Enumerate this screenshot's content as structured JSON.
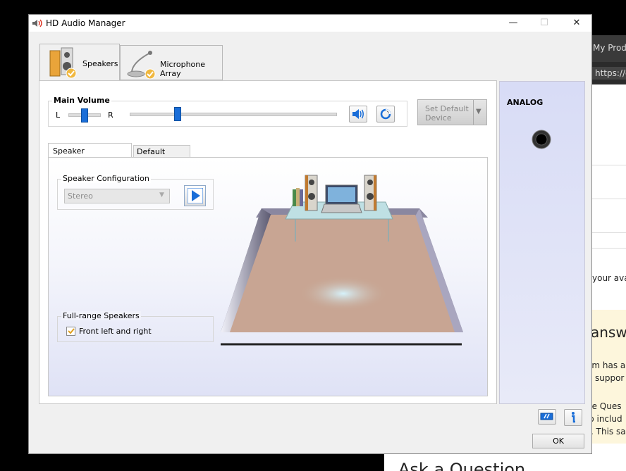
{
  "window": {
    "title": "HD Audio Manager",
    "controls": {
      "minimize": "—",
      "maximize": "☐",
      "close": "✕"
    }
  },
  "tabs": [
    {
      "label": "Speakers",
      "active": true
    },
    {
      "label": "Microphone Array",
      "active": false
    }
  ],
  "main_volume": {
    "label": "Main Volume",
    "balance_left": "L",
    "balance_right": "R",
    "balance_level": 0.5,
    "volume_level": 0.23
  },
  "set_default": {
    "line1": "Set Default",
    "line2": "Device"
  },
  "subtabs": [
    {
      "label": "Speaker Configuration",
      "active": true
    },
    {
      "label": "Default Format",
      "active": false
    }
  ],
  "speaker_config": {
    "group_label": "Speaker Configuration",
    "select_value": "Stereo"
  },
  "full_range": {
    "group_label": "Full-range Speakers",
    "checkbox_label": "Front left and right",
    "checked": true
  },
  "analog": {
    "label": "ANALOG"
  },
  "buttons": {
    "ok": "OK"
  },
  "background": {
    "tab_text": "My Produ",
    "url_text": "https://c",
    "avatar_text": "your avat",
    "answer_text": "answ",
    "text1": "em has a",
    "text2": "suppor",
    "text3": "ne Ques",
    "text4": "lo includ",
    "text5": ". This sa",
    "bottom_text": "Ask a Question"
  },
  "colors": {
    "accent": "#1a6ed8",
    "panel_bg": "#f0f0f0",
    "analog_bg": "#d8dcf6"
  }
}
